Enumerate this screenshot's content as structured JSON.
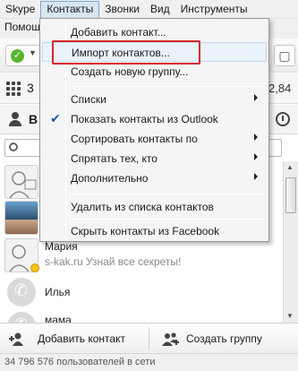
{
  "menubar": {
    "items": [
      "Skype",
      "Контакты",
      "Звонки",
      "Вид",
      "Инструменты"
    ],
    "open_item": "Контакты"
  },
  "row2": {
    "text": "Помощ"
  },
  "credit": {
    "left": "3",
    "right": "2,84"
  },
  "tabs": {
    "contacts_label": "В"
  },
  "search": {
    "placeholder": ""
  },
  "contacts": [
    {
      "name": "",
      "mood": "",
      "avatar": "sketch-icon"
    },
    {
      "name": "",
      "mood": "",
      "avatar": "photo"
    },
    {
      "name": "Мария",
      "mood": "s-kak.ru Узнай все секреты!",
      "avatar": "sketch-icon"
    },
    {
      "name": "Илья",
      "mood": "",
      "avatar": "phone-icon"
    },
    {
      "name": "мама",
      "mood": "",
      "avatar": "phone-icon"
    }
  ],
  "bottom": {
    "add_contact": "Добавить контакт",
    "create_group": "Создать группу"
  },
  "statusbar": {
    "text": "34 796 576 пользователей в сети"
  },
  "dropdown": {
    "items": [
      {
        "label": "Добавить контакт...",
        "submenu": false,
        "checked": false
      },
      {
        "label": "Импорт контактов...",
        "submenu": false,
        "checked": false
      },
      {
        "label": "Создать новую группу...",
        "submenu": false,
        "checked": false
      },
      {
        "label": "Списки",
        "submenu": true,
        "checked": false
      },
      {
        "label": "Показать контакты из Outlook",
        "submenu": false,
        "checked": true
      },
      {
        "label": "Сортировать контакты по",
        "submenu": true,
        "checked": false
      },
      {
        "label": "Спрятать тех, кто",
        "submenu": true,
        "checked": false
      },
      {
        "label": "Дополнительно",
        "submenu": true,
        "checked": false
      },
      {
        "label": "Удалить из списка контактов",
        "submenu": false,
        "checked": false
      },
      {
        "label": "Скрыть контакты из Facebook",
        "submenu": false,
        "checked": false
      }
    ],
    "highlighted_item": "Импорт контактов...",
    "highlight_color": "#d9262a"
  },
  "colors": {
    "accent": "#1e5aa8",
    "status_online": "#58b52e",
    "presence_away": "#f2c318"
  }
}
